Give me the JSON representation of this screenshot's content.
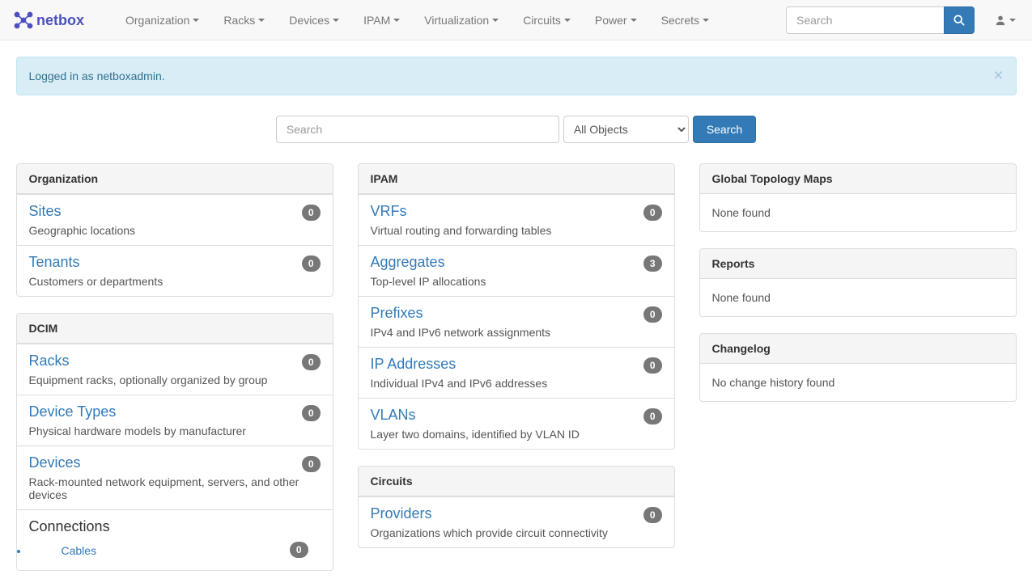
{
  "brand": "netbox",
  "nav": {
    "items": [
      "Organization",
      "Racks",
      "Devices",
      "IPAM",
      "Virtualization",
      "Circuits",
      "Power",
      "Secrets"
    ]
  },
  "navbar_search": {
    "placeholder": "Search"
  },
  "alert_text": "Logged in as netboxadmin.",
  "main_search": {
    "placeholder": "Search",
    "select_value": "All Objects",
    "button_label": "Search"
  },
  "left_panels": [
    {
      "title": "Organization",
      "items": [
        {
          "name": "Sites",
          "desc": "Geographic locations",
          "count": "0"
        },
        {
          "name": "Tenants",
          "desc": "Customers or departments",
          "count": "0"
        }
      ]
    },
    {
      "title": "DCIM",
      "items": [
        {
          "name": "Racks",
          "desc": "Equipment racks, optionally organized by group",
          "count": "0"
        },
        {
          "name": "Device Types",
          "desc": "Physical hardware models by manufacturer",
          "count": "0"
        },
        {
          "name": "Devices",
          "desc": "Rack-mounted network equipment, servers, and other devices",
          "count": "0"
        },
        {
          "name": "Connections",
          "desc": "",
          "count": "",
          "noncolor": true,
          "sub": [
            {
              "name": "Cables",
              "count": "0"
            }
          ]
        }
      ]
    }
  ],
  "mid_panels": [
    {
      "title": "IPAM",
      "items": [
        {
          "name": "VRFs",
          "desc": "Virtual routing and forwarding tables",
          "count": "0"
        },
        {
          "name": "Aggregates",
          "desc": "Top-level IP allocations",
          "count": "3"
        },
        {
          "name": "Prefixes",
          "desc": "IPv4 and IPv6 network assignments",
          "count": "0"
        },
        {
          "name": "IP Addresses",
          "desc": "Individual IPv4 and IPv6 addresses",
          "count": "0"
        },
        {
          "name": "VLANs",
          "desc": "Layer two domains, identified by VLAN ID",
          "count": "0"
        }
      ]
    },
    {
      "title": "Circuits",
      "items": [
        {
          "name": "Providers",
          "desc": "Organizations which provide circuit connectivity",
          "count": "0"
        }
      ]
    }
  ],
  "right_panels": [
    {
      "title": "Global Topology Maps",
      "body": "None found"
    },
    {
      "title": "Reports",
      "body": "None found"
    },
    {
      "title": "Changelog",
      "body": "No change history found"
    }
  ]
}
